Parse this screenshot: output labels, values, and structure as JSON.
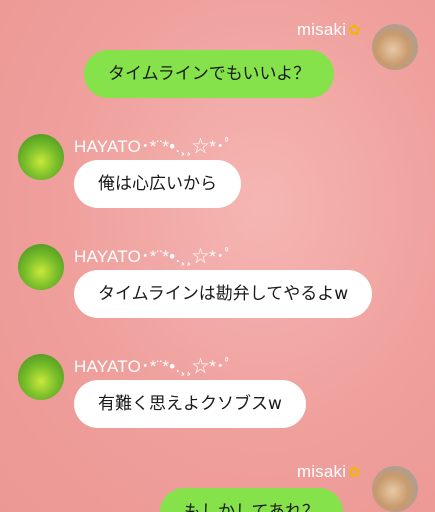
{
  "messages": [
    {
      "side": "right",
      "sender": "misaki",
      "sender_icon": "sunflower-icon",
      "text": "タイムラインでもいいよ？",
      "bubble_color": "#85e24a"
    },
    {
      "side": "left",
      "sender": "HAYATO･*¨*•.¸¸☆*･ﾟ",
      "text": "俺は心広いから",
      "bubble_color": "#ffffff"
    },
    {
      "side": "left",
      "sender": "HAYATO･*¨*•.¸¸☆*･ﾟ",
      "text": "タイムラインは勘弁してやるよw",
      "bubble_color": "#ffffff"
    },
    {
      "side": "left",
      "sender": "HAYATO･*¨*•.¸¸☆*･ﾟ",
      "text": "有難く思えよクソブスw",
      "bubble_color": "#ffffff"
    },
    {
      "side": "right",
      "sender": "misaki",
      "sender_icon": "sunflower-icon",
      "text": "もしかしてあれ？",
      "bubble_color": "#85e24a"
    }
  ]
}
